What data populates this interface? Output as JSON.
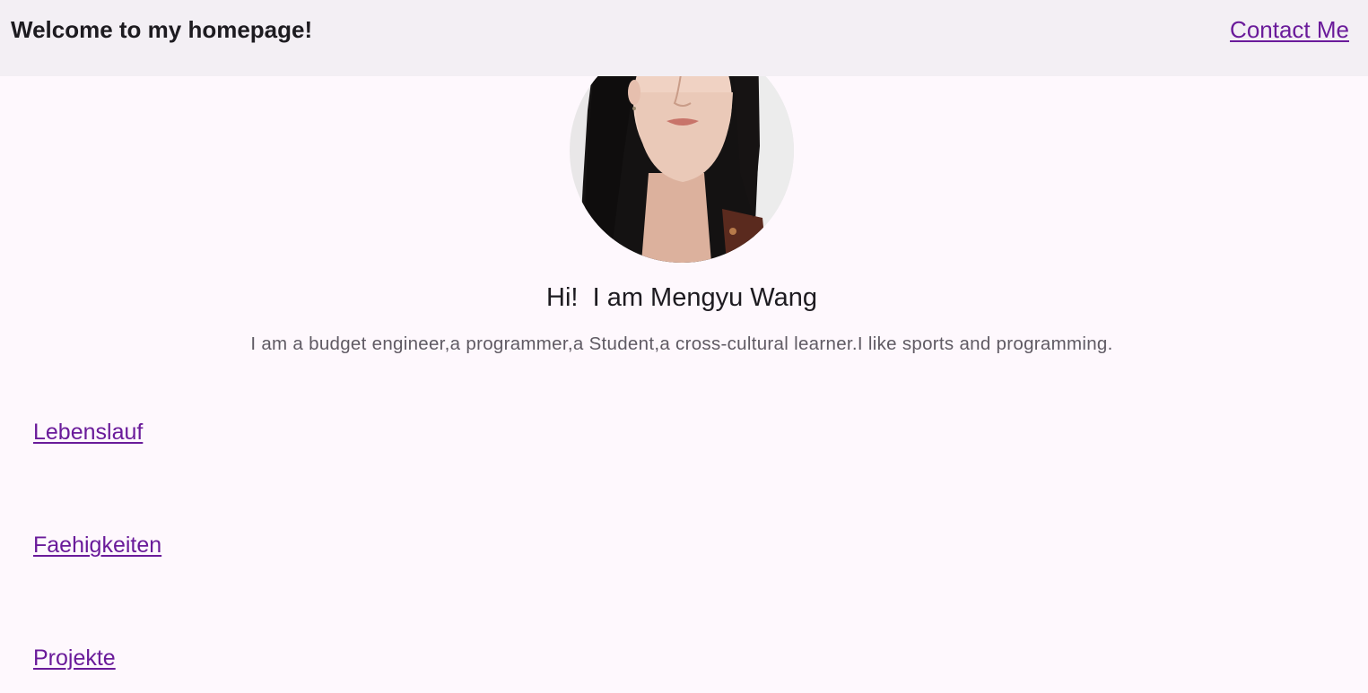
{
  "header": {
    "title": "Welcome to my homepage!",
    "contact_label": "Contact Me"
  },
  "profile": {
    "greeting": "Hi!  I am Mengyu Wang",
    "intro": "I am a budget engineer,a programmer,a Student,a cross-cultural learner.I like sports and programming."
  },
  "sections": [
    {
      "label": "Lebenslauf"
    },
    {
      "label": "Faehigkeiten"
    },
    {
      "label": "Projekte"
    }
  ],
  "colors": {
    "background": "#fef8fd",
    "header_background": "#f3eff4",
    "link": "#6a1b9a",
    "text": "#1d1b20",
    "muted_text": "#5f5a63"
  }
}
